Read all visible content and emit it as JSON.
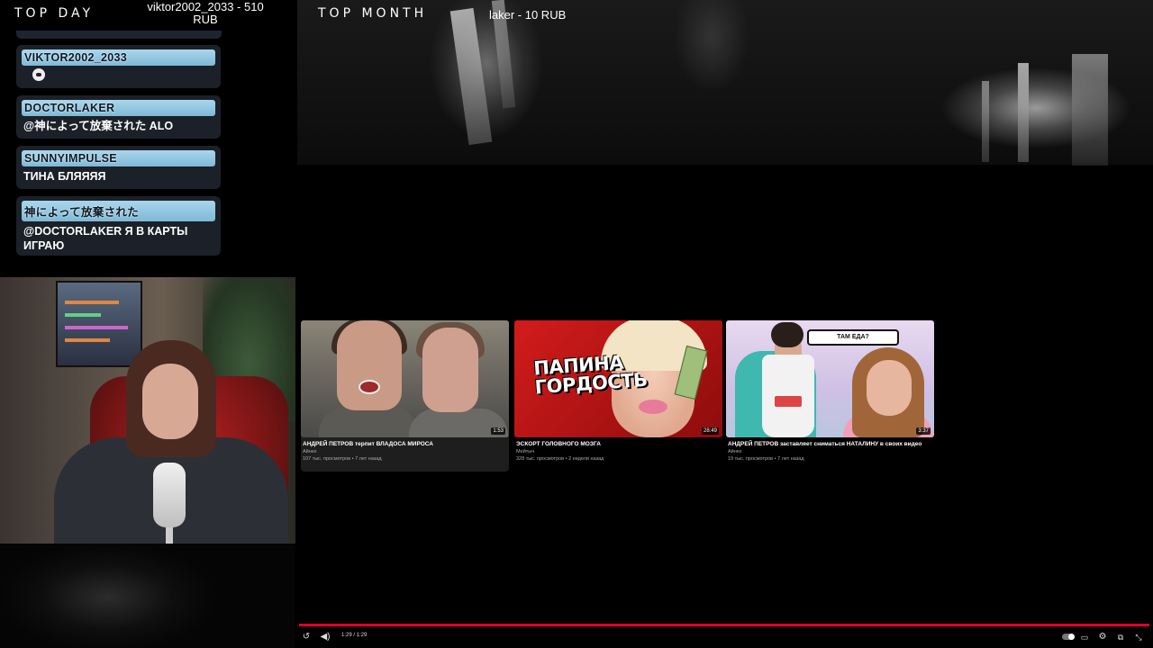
{
  "topbar": {
    "top_day_label": "TOP DAY",
    "top_day_value": "viktor2002_2033 - 510 RUB",
    "top_month_label": "TOP MONTH",
    "top_month_value": "laker - 10 RUB"
  },
  "chat": {
    "messages": [
      {
        "username": "VIKTOR2002_2033",
        "text": "",
        "emote": "cat-emote"
      },
      {
        "username": "DOCTORLAKER",
        "text": "@神によって放棄された ALO"
      },
      {
        "username": "SUNNYIMPULSE",
        "text": "ТИНА БЛЯЯЯЯ"
      },
      {
        "username": "神によって放棄された",
        "text": "@DOCTORLAKER Я В КАРТЫ ИГРАЮ"
      }
    ]
  },
  "videos": [
    {
      "title": "АНДРЕЙ ПЕТРОВ терпит ВЛАДОСА МИРОСА",
      "channel": "Айнех",
      "meta": "107 тыс. просмотров • 7 лет назад",
      "duration": "1:53"
    },
    {
      "title": "ЭСКОРТ ГОЛОВНОГО МОЗГА",
      "channel": "Мейтыч",
      "meta": "328 тыс. просмотров • 2 недели назад",
      "duration": "28:49",
      "thumb_text": "ПАПИНА ГОРДОСТЬ"
    },
    {
      "title": "АНДРЕЙ ПЕТРОВ заставляет сниматься НАТАЛИНУ в своих видео",
      "channel": "Айнех",
      "meta": "19 тыс. просмотров • 7 лет назад",
      "duration": "3:37",
      "thumb_text": "ТАМ ЕДА?"
    }
  ],
  "player": {
    "time": "1:29 / 1:29",
    "progress_fraction": 1.0,
    "accent_color": "#e1002d",
    "icons": [
      "replay-icon",
      "volume-icon",
      "autoplay-toggle",
      "subtitles-icon",
      "settings-icon",
      "miniplayer-icon",
      "fullscreen-exit-icon"
    ]
  }
}
